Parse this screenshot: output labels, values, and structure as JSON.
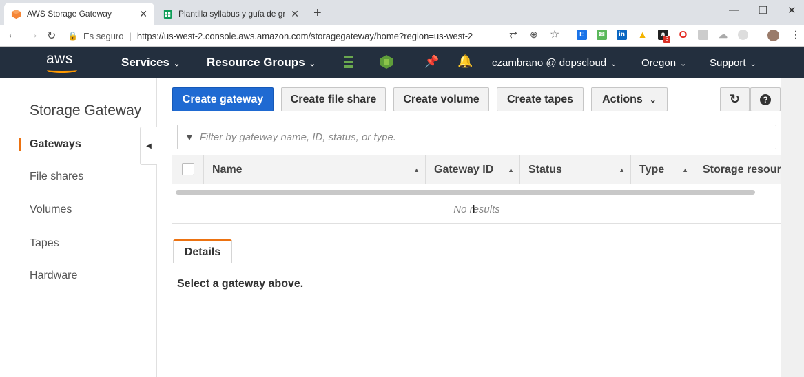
{
  "browser": {
    "tabs": [
      {
        "title": "AWS Storage Gateway",
        "close": "✕"
      },
      {
        "title": "Plantilla syllabus y guía de graba",
        "close": "✕"
      }
    ],
    "new_tab": "+",
    "window_controls": {
      "minimize": "—",
      "restore": "❐",
      "close": "✕"
    },
    "nav": {
      "back": "←",
      "forward": "→",
      "reload": "↻"
    },
    "address": {
      "secure_label": "Es seguro",
      "url": "https://us-west-2.console.aws.amazon.com/storagegateway/home?region=us-west-2"
    },
    "extension_badge": "3"
  },
  "aws_nav": {
    "logo": "aws",
    "services": "Services",
    "resource_groups": "Resource Groups",
    "account": "czambrano @ dopscloud",
    "region": "Oregon",
    "support": "Support",
    "caret": "⌄"
  },
  "sidebar": {
    "title": "Storage Gateway",
    "items": [
      {
        "label": "Gateways",
        "active": true
      },
      {
        "label": "File shares"
      },
      {
        "label": "Volumes"
      },
      {
        "label": "Tapes"
      },
      {
        "label": "Hardware"
      }
    ],
    "collapse": "◀"
  },
  "toolbar": {
    "create_gateway": "Create gateway",
    "create_file_share": "Create file share",
    "create_volume": "Create volume",
    "create_tapes": "Create tapes",
    "actions": "Actions",
    "actions_caret": "⌄",
    "refresh": "↻",
    "help": "?"
  },
  "filter": {
    "placeholder": "Filter by gateway name, ID, status, or type."
  },
  "table": {
    "columns": [
      "Name",
      "Gateway ID",
      "Status",
      "Type",
      "Storage resourc"
    ],
    "sort_glyph": "▲",
    "empty": "No results"
  },
  "details": {
    "tab": "Details",
    "message": "Select a gateway above."
  },
  "colors": {
    "aws_nav_bg": "#232f3e",
    "primary_button": "#1f6ad2",
    "accent_orange": "#ec7211"
  }
}
